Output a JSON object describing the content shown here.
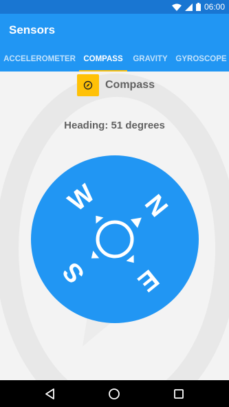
{
  "status_bar": {
    "time": "06:00",
    "icons": [
      "wifi-icon",
      "signal-icon",
      "battery-icon"
    ]
  },
  "app_bar": {
    "title": "Sensors"
  },
  "tabs": [
    {
      "label": "ACCELEROMETER",
      "active": false
    },
    {
      "label": "COMPASS",
      "active": true
    },
    {
      "label": "GRAVITY",
      "active": false
    },
    {
      "label": "GYROSCOPE",
      "active": false
    }
  ],
  "compass": {
    "title": "Compass",
    "icon": "compass-icon",
    "heading_text": "Heading: 51 degrees",
    "heading_degrees": 51,
    "directions": {
      "north": "N",
      "east": "E",
      "south": "S",
      "west": "W"
    }
  },
  "nav_bar": {
    "buttons": [
      "back-icon",
      "home-icon",
      "recents-icon"
    ]
  },
  "colors": {
    "status_bar": "#1976D2",
    "app_bar": "#2196F3",
    "accent": "#FFC107",
    "dial": "#2196F3",
    "background": "#F3F3F3",
    "text": "#616161"
  }
}
